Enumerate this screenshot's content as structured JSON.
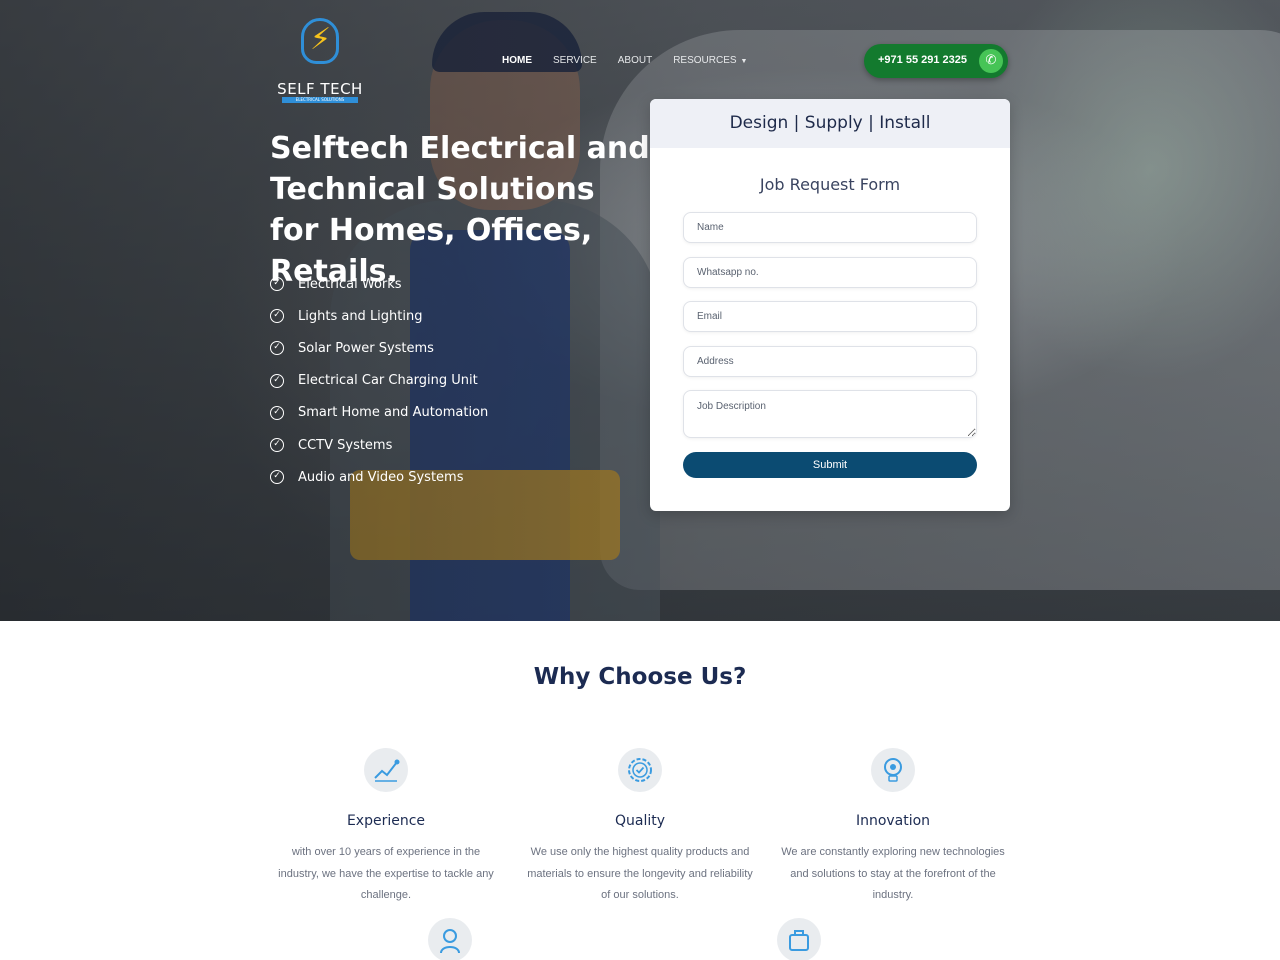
{
  "brand": {
    "name": "SELF TECH",
    "tagline": "ELECTRICAL SOLUTIONS"
  },
  "nav": {
    "items": [
      {
        "label": "HOME",
        "active": true
      },
      {
        "label": "SERVICE",
        "active": false
      },
      {
        "label": "ABOUT",
        "active": false
      },
      {
        "label": "RESOURCES",
        "active": false,
        "dropdown": true
      }
    ],
    "phone": "+971 55 291 2325"
  },
  "hero": {
    "title": "Selftech Electrical and Technical Solutions for Homes, Offices, Retails.",
    "features": [
      "Electrical Works",
      "Lights and Lighting",
      "Solar Power Systems",
      "Electrical Car Charging Unit",
      "Smart Home and Automation",
      "CCTV Systems",
      "Audio and Video Systems"
    ]
  },
  "form": {
    "header": "Design | Supply | Install",
    "title": "Job Request Form",
    "fields": {
      "name": "Name",
      "whatsapp": "Whatsapp no.",
      "email": "Email",
      "address": "Address",
      "description": "Job Description"
    },
    "submit": "Submit"
  },
  "why": {
    "title": "Why Choose Us?",
    "items": [
      {
        "name": "Experience",
        "icon": "experience-chart-icon",
        "desc": "with over 10 years of experience in the industry, we have the expertise to tackle any challenge."
      },
      {
        "name": "Quality",
        "icon": "quality-badge-icon",
        "desc": "We use only the highest quality products and materials to ensure the longevity and reliability of our solutions."
      },
      {
        "name": "Innovation",
        "icon": "innovation-bulb-icon",
        "desc": "We are constantly exploring new technologies and solutions to stay at the forefront of the industry."
      }
    ]
  },
  "colors": {
    "primary": "#0b4b72",
    "phone_green": "#137a2e",
    "heading": "#1c2b52",
    "icon_blue": "#3a9be0"
  }
}
